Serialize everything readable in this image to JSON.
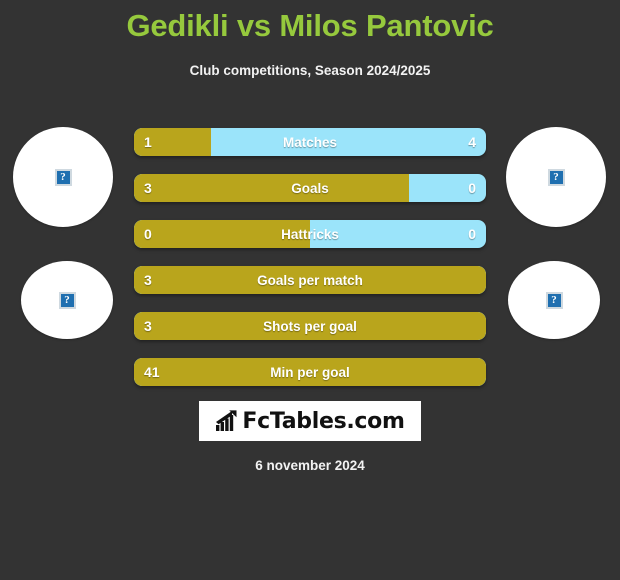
{
  "header": {
    "title": "Gedikli vs Milos Pantovic",
    "subtitle": "Club competitions, Season 2024/2025"
  },
  "colors": {
    "background": "#333333",
    "title_green": "#96c93d",
    "home_gold": "#b9a51c",
    "away_blue": "#9be4fa",
    "text_white": "#ffffff"
  },
  "avatars": {
    "placeholder_glyph": "?",
    "left": [
      {
        "name": "home-player-photo",
        "alt": "broken-image-icon"
      },
      {
        "name": "home-club-logo",
        "alt": "broken-image-icon"
      }
    ],
    "right": [
      {
        "name": "away-player-photo",
        "alt": "broken-image-icon"
      },
      {
        "name": "away-club-logo",
        "alt": "broken-image-icon"
      }
    ]
  },
  "stats": [
    {
      "label": "Matches",
      "home": "1",
      "away": "4",
      "home_pct": 22,
      "show_away": true
    },
    {
      "label": "Goals",
      "home": "3",
      "away": "0",
      "home_pct": 78,
      "show_away": true
    },
    {
      "label": "Hattricks",
      "home": "0",
      "away": "0",
      "home_pct": 50,
      "show_away": true
    },
    {
      "label": "Goals per match",
      "home": "3",
      "away": "",
      "home_pct": 100,
      "show_away": false
    },
    {
      "label": "Shots per goal",
      "home": "3",
      "away": "",
      "home_pct": 100,
      "show_away": false
    },
    {
      "label": "Min per goal",
      "home": "41",
      "away": "",
      "home_pct": 100,
      "show_away": false
    }
  ],
  "footer": {
    "logo_text": "FcTables.com",
    "logo_icon": "bar-chart-arrow-icon",
    "date": "6 november 2024"
  },
  "chart_data": {
    "type": "bar",
    "title": "Gedikli vs Milos Pantovic",
    "subtitle": "Club competitions, Season 2024/2025",
    "orientation": "horizontal-diverging",
    "categories": [
      "Matches",
      "Goals",
      "Hattricks",
      "Goals per match",
      "Shots per goal",
      "Min per goal"
    ],
    "series": [
      {
        "name": "Gedikli",
        "color": "#b9a51c",
        "values": [
          1,
          3,
          0,
          3,
          3,
          41
        ]
      },
      {
        "name": "Milos Pantovic",
        "color": "#9be4fa",
        "values": [
          4,
          0,
          0,
          null,
          null,
          null
        ]
      }
    ],
    "legend": "none",
    "grid": false,
    "notes": "Each row is a full-width bar split proportionally; rows 4-6 have no opponent value and render fully gold."
  }
}
